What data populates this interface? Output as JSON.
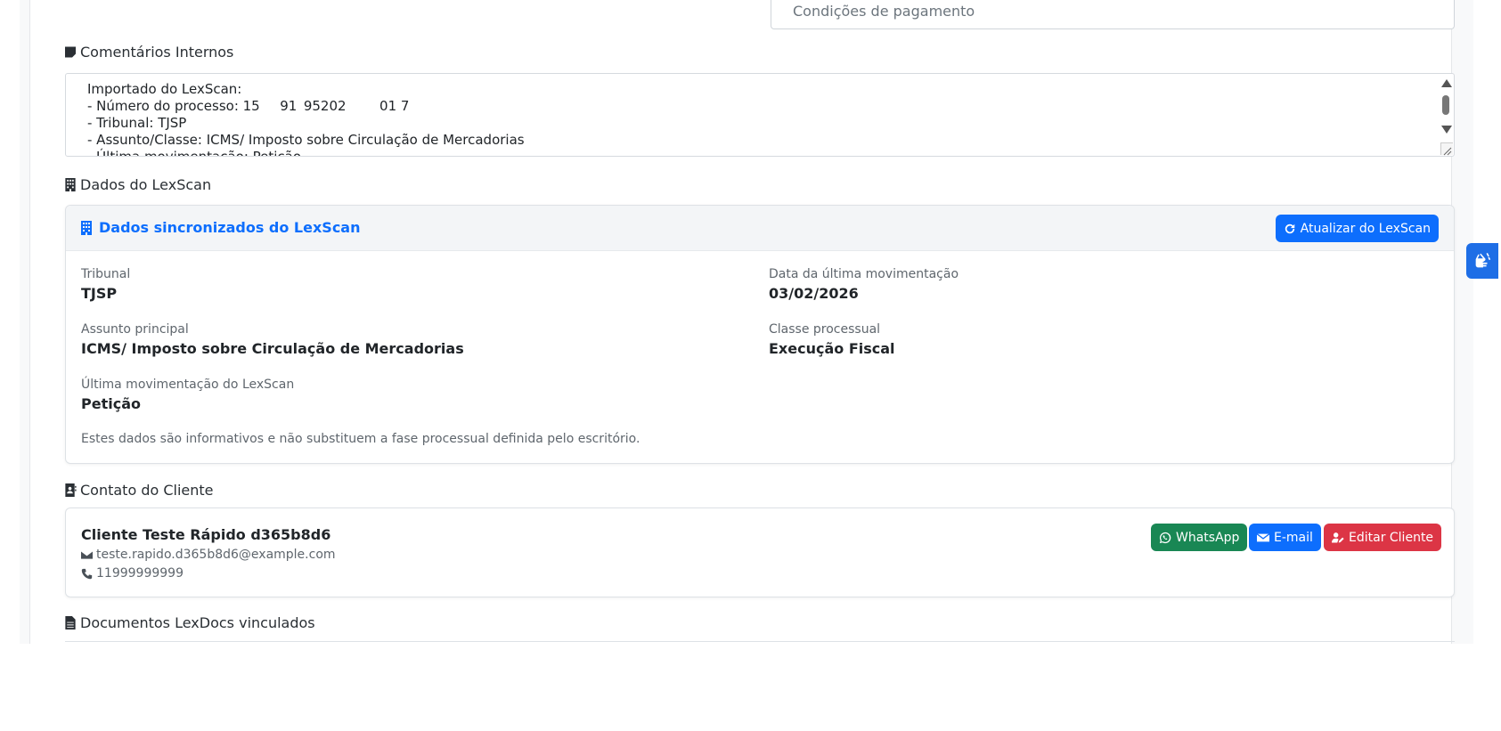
{
  "payment": {
    "placeholder": "Condições de pagamento"
  },
  "comments": {
    "title": "Comentários Internos",
    "text": "Importado do LexScan:\n- Número do processo: 15   91 95202     01 7\n- Tribunal: TJSP\n- Assunto/Classe: ICMS/ Imposto sobre Circulação de Mercadorias\n- Última movimentação: Petição"
  },
  "lexscan": {
    "section_title": "Dados do LexScan",
    "card_title": "Dados sincronizados do LexScan",
    "refresh_button": "Atualizar do LexScan",
    "fields": [
      {
        "label": "Tribunal",
        "value": "TJSP"
      },
      {
        "label": "Data da última movimentação",
        "value": "03/02/2026"
      },
      {
        "label": "Assunto principal",
        "value": "ICMS/ Imposto sobre Circulação de Mercadorias"
      },
      {
        "label": "Classe processual",
        "value": "Execução Fiscal"
      },
      {
        "label": "Última movimentação do LexScan",
        "value": "Petição"
      }
    ],
    "note": "Estes dados são informativos e não substituem a fase processual definida pelo escritório."
  },
  "client": {
    "section_title": "Contato do Cliente",
    "name": "Cliente Teste Rápido d365b8d6",
    "email": "teste.rapido.d365b8d6@example.com",
    "phone": "11999999999",
    "buttons": {
      "whatsapp": "WhatsApp",
      "email": "E-mail",
      "edit": "Editar Cliente"
    }
  },
  "documents": {
    "section_title": "Documentos LexDocs vinculados"
  },
  "colors": {
    "primary": "#0d6efd",
    "success": "#198754",
    "danger": "#dc3545",
    "a11y": "#1e6ee6"
  },
  "icons": [
    "sticky-note-icon",
    "building-icon",
    "refresh-icon",
    "address-card-icon",
    "whatsapp-icon",
    "envelope-icon",
    "user-edit-icon",
    "phone-icon",
    "file-icon",
    "sign-language-icon"
  ]
}
